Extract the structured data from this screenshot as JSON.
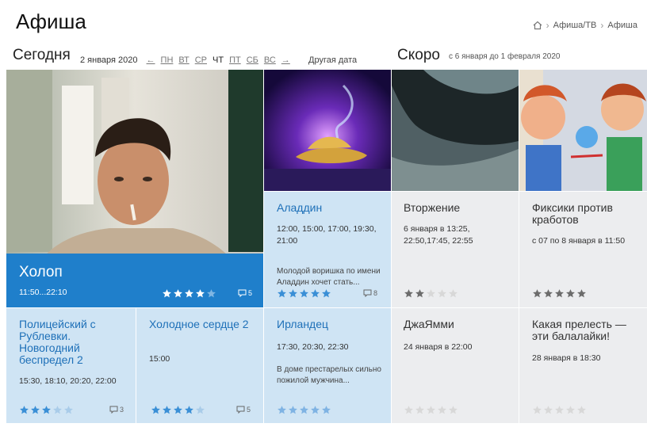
{
  "header": {
    "title": "Афиша",
    "breadcrumb": [
      "Афиша/ТВ",
      "Афиша"
    ]
  },
  "today": {
    "title": "Сегодня",
    "date": "2 января 2020",
    "prev": "←",
    "next": "→",
    "days": [
      "ПН",
      "ВТ",
      "СР",
      "ЧТ",
      "ПТ",
      "СБ",
      "ВС"
    ],
    "current_day": "ЧТ",
    "other_date": "Другая дата"
  },
  "soon": {
    "title": "Скоро",
    "range": "с 6 января до 1 февраля 2020"
  },
  "featured": {
    "title": "Холоп",
    "time": "11:50...22:10",
    "rating": 4,
    "comments": "5"
  },
  "movies": [
    {
      "id": "aladdin",
      "title": "Аладдин",
      "time": "12:00, 15:00, 17:00, 19:30, 21:00",
      "desc": "Молодой воришка по имени Аладдин хочет стать...",
      "rating": 5,
      "comments": "8"
    },
    {
      "id": "vtorzhenie",
      "title": "Вторжение",
      "time": "6 января в 13:25, 22:50,17:45, 22:55",
      "rating": 2
    },
    {
      "id": "fixiki",
      "title": "Фиксики против кработов",
      "time": "с 07 по 8 января в 11:50",
      "rating": 5
    },
    {
      "id": "politseyskiy",
      "title": "Полицейский с Рублевки. Новогодний беспредел 2",
      "time": "15:30, 18:10, 20:20, 22:00",
      "rating": 3,
      "comments": "3"
    },
    {
      "id": "kholodnoe",
      "title": "Холодное сердце 2",
      "time": "15:00",
      "rating": 4,
      "comments": "5"
    },
    {
      "id": "irlandets",
      "title": "Ирландец",
      "time": "17:30, 20:30, 22:30",
      "desc": "В доме престарелых сильно пожилой мужчина...",
      "rating": 5
    },
    {
      "id": "dzhayammi",
      "title": "ДжаЯмми",
      "time": "24 января в 22:00",
      "rating": 0
    },
    {
      "id": "balalayki",
      "title": "Какая прелесть — эти балалайки!",
      "time": "28 января в 18:30",
      "rating": 0
    }
  ],
  "colors": {
    "accent_blue": "#1e70b8",
    "today_tile": "#cfe4f4",
    "soon_tile": "#ecedef",
    "featured_band": "#1f7fcb",
    "star_blue": "#3a8fd6",
    "star_gray": "#6c6c6c",
    "star_empty": "#d8d8d8"
  }
}
